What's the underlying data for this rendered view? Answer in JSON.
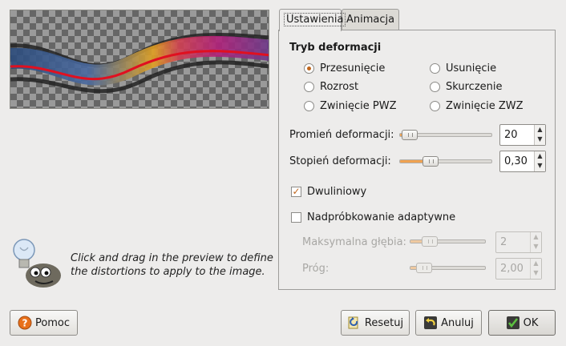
{
  "tabs": [
    {
      "label": "Ustawienia",
      "active": true
    },
    {
      "label": "Animacja",
      "active": false
    }
  ],
  "deform": {
    "group_title": "Tryb deformacji",
    "modes": [
      {
        "label": "Przesunięcie",
        "selected": true
      },
      {
        "label": "Usunięcie",
        "selected": false
      },
      {
        "label": "Rozrost",
        "selected": false
      },
      {
        "label": "Skurczenie",
        "selected": false
      },
      {
        "label": "Zwinięcie PWZ",
        "selected": false
      },
      {
        "label": "Zwinięcie ZWZ",
        "selected": false
      }
    ]
  },
  "radius": {
    "label": "Promień deformacji:",
    "value": "20",
    "fraction": 0.03
  },
  "amount": {
    "label": "Stopień deformacji:",
    "value": "0,30",
    "fraction": 0.3
  },
  "bilinear": {
    "label": "Dwuliniowy",
    "checked": true
  },
  "supersample": {
    "label": "Nadpróbkowanie adaptywne",
    "checked": false
  },
  "max_depth": {
    "label": "Maksymalna głębia:",
    "value": "2",
    "fraction": 0.2
  },
  "threshold": {
    "label": "Próg:",
    "value": "2,00",
    "fraction": 0.1
  },
  "hint": {
    "text": "Click and drag in the preview to define the distortions to apply to the image."
  },
  "buttons": {
    "help": "Pomoc",
    "reset": "Resetuj",
    "cancel": "Anuluj",
    "ok": "OK"
  },
  "colors": {
    "accent": "#c0661c",
    "slider_fill": "#f0a250",
    "ok_icon": "#3b9a2a"
  }
}
